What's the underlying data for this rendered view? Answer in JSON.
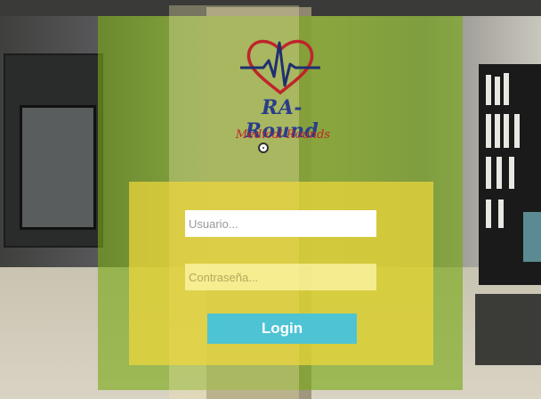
{
  "app": {
    "logo_title": "RA-Round",
    "logo_subtitle": "Medical Rounds"
  },
  "form": {
    "username_placeholder": "Usuario...",
    "password_placeholder": "Contraseña...",
    "login_label": "Login"
  },
  "colors": {
    "login_button": "#4ec3d4",
    "panel_green": "#78aa14",
    "panel_yellow": "#f0d73c",
    "logo_blue": "#2a3d8c",
    "logo_red": "#c0242a"
  },
  "icons": {
    "logo": "heart-ecg-icon",
    "cursor": "gaze-cursor-icon"
  }
}
